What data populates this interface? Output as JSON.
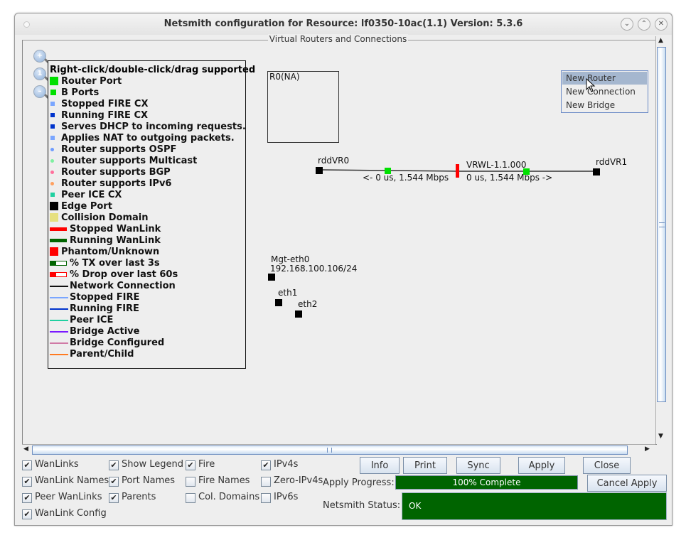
{
  "window": {
    "title": "Netsmith configuration for Resource:  lf0350-10ac(1.1)  Version: 5.3.6",
    "buttons": [
      "minimize",
      "maximize",
      "close"
    ]
  },
  "panel": {
    "title": "Virtual Routers and Connections"
  },
  "zoom_controls": [
    "zoom-in",
    "zoom-reset",
    "zoom-out"
  ],
  "legend": {
    "header": "Right-click/double-click/drag supported",
    "items": [
      {
        "label": "Router Port",
        "kind": "square-large",
        "color": "#00e000"
      },
      {
        "label": "B Ports",
        "kind": "square",
        "color": "#00e000"
      },
      {
        "label": "Stopped FIRE CX",
        "kind": "square-small",
        "color": "#7aa6ff"
      },
      {
        "label": "Running FIRE CX",
        "kind": "square-small",
        "color": "#0033cc"
      },
      {
        "label": "Serves DHCP to incoming requests.",
        "kind": "square-small",
        "color": "#0033cc"
      },
      {
        "label": "Applies NAT to outgoing packets.",
        "kind": "square-small",
        "color": "#7aa6ff"
      },
      {
        "label": "Router supports OSPF",
        "kind": "dot",
        "color": "#6f9cff"
      },
      {
        "label": "Router supports Multicast",
        "kind": "dot",
        "color": "#7ef0a0"
      },
      {
        "label": "Router supports BGP",
        "kind": "dot",
        "color": "#ff6f9c"
      },
      {
        "label": "Router supports IPv6",
        "kind": "dot",
        "color": "#ffa060"
      },
      {
        "label": "Peer ICE CX",
        "kind": "square-small",
        "color": "#20d0a0"
      },
      {
        "label": "Edge Port",
        "kind": "square-large",
        "color": "#000000"
      },
      {
        "label": "Collision Domain",
        "kind": "square-large",
        "color": "#e6e080"
      },
      {
        "label": "Stopped WanLink",
        "kind": "bar",
        "color": "#ff0000"
      },
      {
        "label": "Running WanLink",
        "kind": "bar",
        "color": "#006400"
      },
      {
        "label": "Phantom/Unknown",
        "kind": "square-large",
        "color": "#ff0000"
      },
      {
        "label": "% TX over last 3s",
        "kind": "meter",
        "color": "#006400"
      },
      {
        "label": "% Drop over last 60s",
        "kind": "meter",
        "color": "#ff0000"
      },
      {
        "label": "Network Connection",
        "kind": "line",
        "color": "#111111"
      },
      {
        "label": "Stopped FIRE",
        "kind": "line",
        "color": "#7aa6ff"
      },
      {
        "label": "Running FIRE",
        "kind": "line",
        "color": "#0033cc"
      },
      {
        "label": "Peer ICE",
        "kind": "line",
        "color": "#20d0a0"
      },
      {
        "label": "Bridge Active",
        "kind": "line",
        "color": "#7a1aff"
      },
      {
        "label": "Bridge Configured",
        "kind": "line",
        "color": "#d07aa6"
      },
      {
        "label": "Parent/Child",
        "kind": "line",
        "color": "#ff7a20"
      }
    ]
  },
  "topology": {
    "router_box_label": "R0(NA)",
    "endpoint_left": "rddVR0",
    "endpoint_right": "rddVR1",
    "wanlink_name": "VRWL-1.1.000",
    "left_stats": "<- 0 us, 1.544 Mbps",
    "right_stats": "0 us, 1.544 Mbps ->",
    "ports": [
      {
        "name": "Mgt-eth0",
        "ip": "192.168.100.106/24"
      },
      {
        "name": "eth1"
      },
      {
        "name": "eth2"
      }
    ]
  },
  "context_menu": {
    "items": [
      "New Router",
      "New Connection",
      "New Bridge"
    ],
    "selected": "New Router"
  },
  "options": {
    "checkboxes": [
      {
        "label": "WanLinks",
        "checked": true
      },
      {
        "label": "WanLink Names",
        "checked": true
      },
      {
        "label": "Peer WanLinks",
        "checked": true
      },
      {
        "label": "WanLink Config",
        "checked": true
      },
      {
        "label": "Show Legend",
        "checked": true
      },
      {
        "label": "Port Names",
        "checked": true
      },
      {
        "label": "Parents",
        "checked": true
      },
      {
        "label": "Fire",
        "checked": true
      },
      {
        "label": "Fire Names",
        "checked": false
      },
      {
        "label": "Col. Domains",
        "checked": false
      },
      {
        "label": "IPv4s",
        "checked": true
      },
      {
        "label": "Zero-IPv4s",
        "checked": false
      },
      {
        "label": "IPv6s",
        "checked": false
      }
    ]
  },
  "actions": {
    "info": "Info",
    "print": "Print",
    "sync": "Sync",
    "apply": "Apply",
    "close": "Close",
    "cancel_apply": "Cancel Apply"
  },
  "apply_progress": {
    "label": "Apply Progress:",
    "text": "100% Complete",
    "percent": 100
  },
  "netsmith_status": {
    "label": "Netsmith Status:",
    "value": "OK"
  },
  "colors": {
    "status_green": "#006400",
    "port_green": "#00e000",
    "wanlink_red": "#ff0000",
    "menu_selected": "#a5b7cf"
  }
}
